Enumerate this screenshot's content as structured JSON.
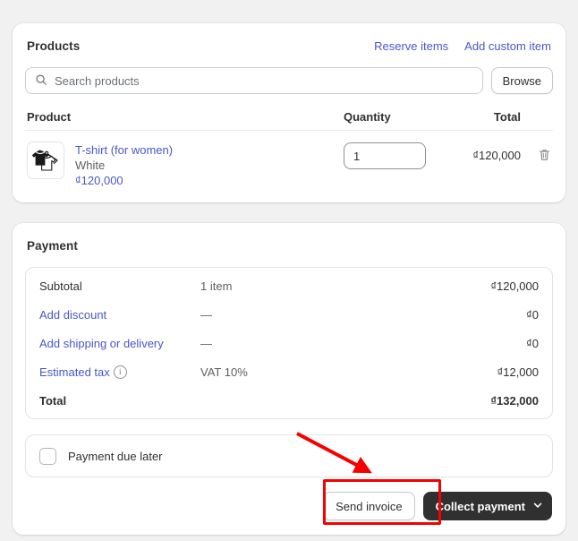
{
  "products": {
    "title": "Products",
    "actions": [
      {
        "label": "Reserve items",
        "name": "reserve-items-link"
      },
      {
        "label": "Add custom item",
        "name": "add-custom-item-link"
      }
    ],
    "search": {
      "placeholder": "Search products",
      "value": ""
    },
    "browse_label": "Browse",
    "columns": {
      "product": "Product",
      "quantity": "Quantity",
      "total": "Total"
    },
    "rows": [
      {
        "title": "T-shirt (for women)",
        "variant": "White",
        "unit_price": "₫120,000",
        "quantity": "1",
        "line_total": "₫120,000"
      }
    ]
  },
  "payment": {
    "title": "Payment",
    "summary": [
      {
        "label": "Subtotal",
        "link": false,
        "info": false,
        "mid": "1 item",
        "amount": "₫120,000",
        "bold": false
      },
      {
        "label": "Add discount",
        "link": true,
        "info": false,
        "mid": "—",
        "amount": "₫0",
        "bold": false
      },
      {
        "label": "Add shipping or delivery",
        "link": true,
        "info": false,
        "mid": "—",
        "amount": "₫0",
        "bold": false
      },
      {
        "label": "Estimated tax",
        "link": true,
        "info": true,
        "mid": "VAT 10%",
        "amount": "₫12,000",
        "bold": false
      },
      {
        "label": "Total",
        "link": false,
        "info": false,
        "mid": "",
        "amount": "₫132,000",
        "bold": true
      }
    ],
    "due_later_label": "Payment due later",
    "due_later_checked": false,
    "send_invoice_label": "Send invoice",
    "collect_payment_label": "Collect payment"
  },
  "icons": {
    "search": "search-icon",
    "trash": "trash-icon",
    "info": "info-icon",
    "chevron_down": "chevron-down-icon",
    "thumbnail": "tshirt-thumbnail-icon"
  },
  "colors": {
    "link": "#4a57c9",
    "primary_button_bg": "#303030",
    "page_bg": "#f1f1f1",
    "annotation_red": "#f60000"
  },
  "annotations": {
    "highlight_target": "Send invoice",
    "arrow": "points-to-send-invoice-button"
  }
}
